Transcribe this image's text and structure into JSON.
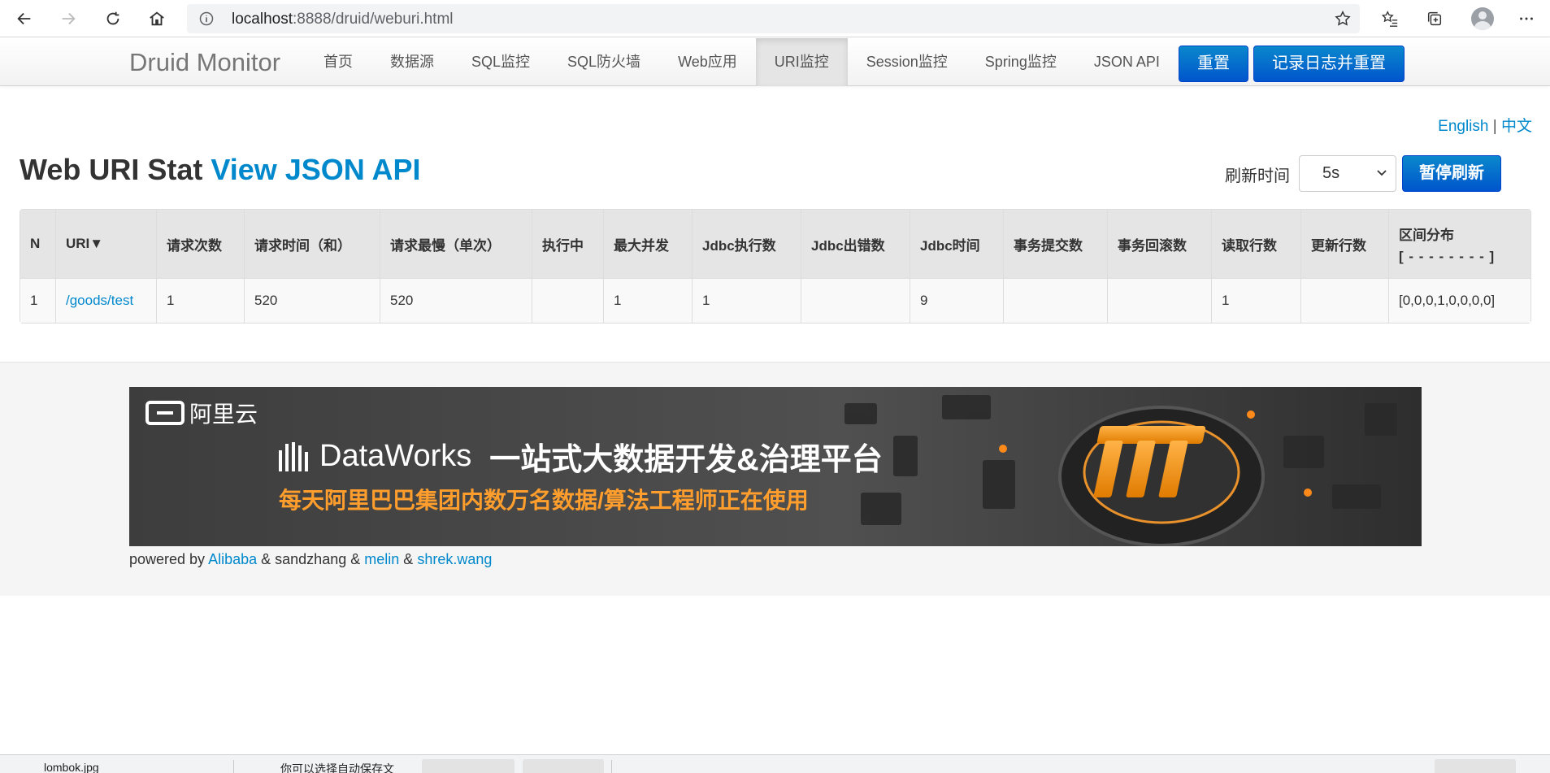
{
  "browser": {
    "url_host": "localhost",
    "url_rest": ":8888/druid/weburi.html",
    "icons": [
      "back-icon",
      "forward-icon",
      "refresh-icon",
      "home-icon",
      "info-icon",
      "star-icon",
      "favorites-icon",
      "collections-icon",
      "profile-icon",
      "more-icon"
    ]
  },
  "navbar": {
    "brand": "Druid Monitor",
    "items": [
      {
        "label": "首页"
      },
      {
        "label": "数据源"
      },
      {
        "label": "SQL监控"
      },
      {
        "label": "SQL防火墙"
      },
      {
        "label": "Web应用"
      },
      {
        "label": "URI监控"
      },
      {
        "label": "Session监控"
      },
      {
        "label": "Spring监控"
      },
      {
        "label": "JSON API"
      }
    ],
    "reset_label": "重置",
    "log_reset_label": "记录日志并重置"
  },
  "lang": {
    "english": "English",
    "sep": "|",
    "chinese": "中文"
  },
  "title": {
    "main": "Web URI Stat",
    "link": "View JSON API"
  },
  "refresh": {
    "label": "刷新时间",
    "value": "5s",
    "pause_label": "暂停刷新"
  },
  "table": {
    "headers": [
      "N",
      "URI▼",
      "请求次数",
      "请求时间（和）",
      "请求最慢（单次）",
      "执行中",
      "最大并发",
      "Jdbc执行数",
      "Jdbc出错数",
      "Jdbc时间",
      "事务提交数",
      "事务回滚数",
      "读取行数",
      "更新行数",
      "区间分布"
    ],
    "dist_sub": "[ - - - - - - - - ]",
    "rows": [
      [
        "1",
        "/goods/test",
        "1",
        "520",
        "520",
        "",
        "1",
        "1",
        "",
        "9",
        "",
        "",
        "1",
        "",
        "[0,0,0,1,0,0,0,0]"
      ]
    ]
  },
  "banner": {
    "logo_text": "阿里云",
    "product": "DataWorks",
    "slogan": "一站式大数据开发&治理平台",
    "subline": "每天阿里巴巴集团内数万名数据/算法工程师正在使用"
  },
  "powered": {
    "prefix": "powered by",
    "alibaba": "Alibaba",
    "amp1": "& sandzhang &",
    "melin": "melin",
    "amp2": "&",
    "shrek": "shrek.wang"
  },
  "download_bar": {
    "file": "lombok.jpg",
    "message": "你可以选择自动保存文"
  },
  "colors": {
    "link": "#0088cc",
    "primary": "#0055cc",
    "banner_accent": "#ff9e2c"
  }
}
